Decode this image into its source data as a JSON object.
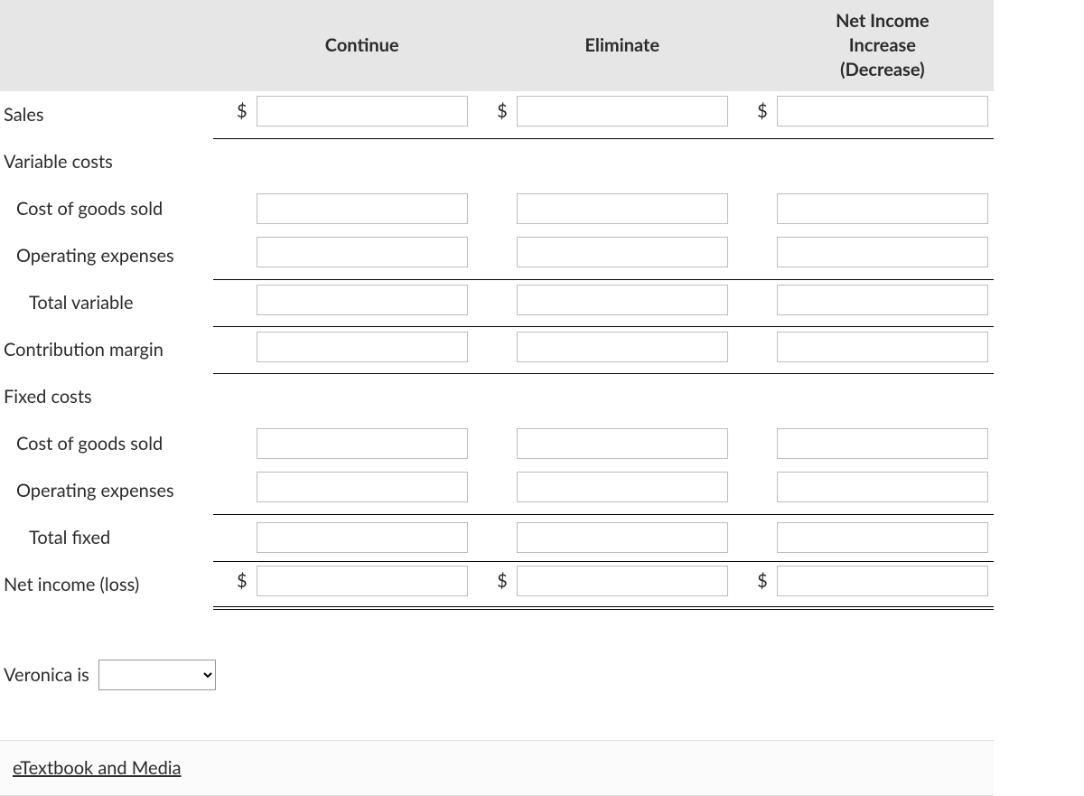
{
  "table": {
    "columns": [
      "Continue",
      "Eliminate",
      "Net Income\nIncrease\n(Decrease)"
    ],
    "currency_symbol": "$",
    "rows": [
      {
        "id": "sales",
        "label": "Sales",
        "indent": 0,
        "has_inputs": true,
        "has_dollar": true,
        "underline": "single",
        "values": [
          "",
          "",
          ""
        ]
      },
      {
        "id": "variable-costs-hdr",
        "label": "Variable costs",
        "indent": 0,
        "has_inputs": false,
        "has_dollar": false,
        "underline": "none"
      },
      {
        "id": "vc-cogs",
        "label": "Cost of goods sold",
        "indent": 1,
        "has_inputs": true,
        "has_dollar": false,
        "underline": "none",
        "values": [
          "",
          "",
          ""
        ]
      },
      {
        "id": "vc-opex",
        "label": "Operating expenses",
        "indent": 1,
        "has_inputs": true,
        "has_dollar": false,
        "underline": "single",
        "values": [
          "",
          "",
          ""
        ]
      },
      {
        "id": "vc-total",
        "label": "Total variable",
        "indent": 2,
        "has_inputs": true,
        "has_dollar": false,
        "underline": "single",
        "values": [
          "",
          "",
          ""
        ]
      },
      {
        "id": "contribution-margin",
        "label": "Contribution margin",
        "indent": 0,
        "has_inputs": true,
        "has_dollar": false,
        "underline": "single",
        "values": [
          "",
          "",
          ""
        ]
      },
      {
        "id": "fixed-costs-hdr",
        "label": "Fixed costs",
        "indent": 0,
        "has_inputs": false,
        "has_dollar": false,
        "underline": "none"
      },
      {
        "id": "fc-cogs",
        "label": "Cost of goods sold",
        "indent": 1,
        "has_inputs": true,
        "has_dollar": false,
        "underline": "none",
        "values": [
          "",
          "",
          ""
        ]
      },
      {
        "id": "fc-opex",
        "label": "Operating expenses",
        "indent": 1,
        "has_inputs": true,
        "has_dollar": false,
        "underline": "single",
        "values": [
          "",
          "",
          ""
        ]
      },
      {
        "id": "fc-total",
        "label": "Total fixed",
        "indent": 2,
        "has_inputs": true,
        "has_dollar": false,
        "underline": "single_top",
        "values": [
          "",
          "",
          ""
        ]
      },
      {
        "id": "net-income",
        "label": "Net income (loss)",
        "indent": 0,
        "has_inputs": true,
        "has_dollar": true,
        "underline": "double",
        "values": [
          "",
          "",
          ""
        ]
      }
    ]
  },
  "dropdown": {
    "label": "Veronica is",
    "selected": "",
    "options": [
      ""
    ]
  },
  "etextbook_link": "eTextbook and Media"
}
